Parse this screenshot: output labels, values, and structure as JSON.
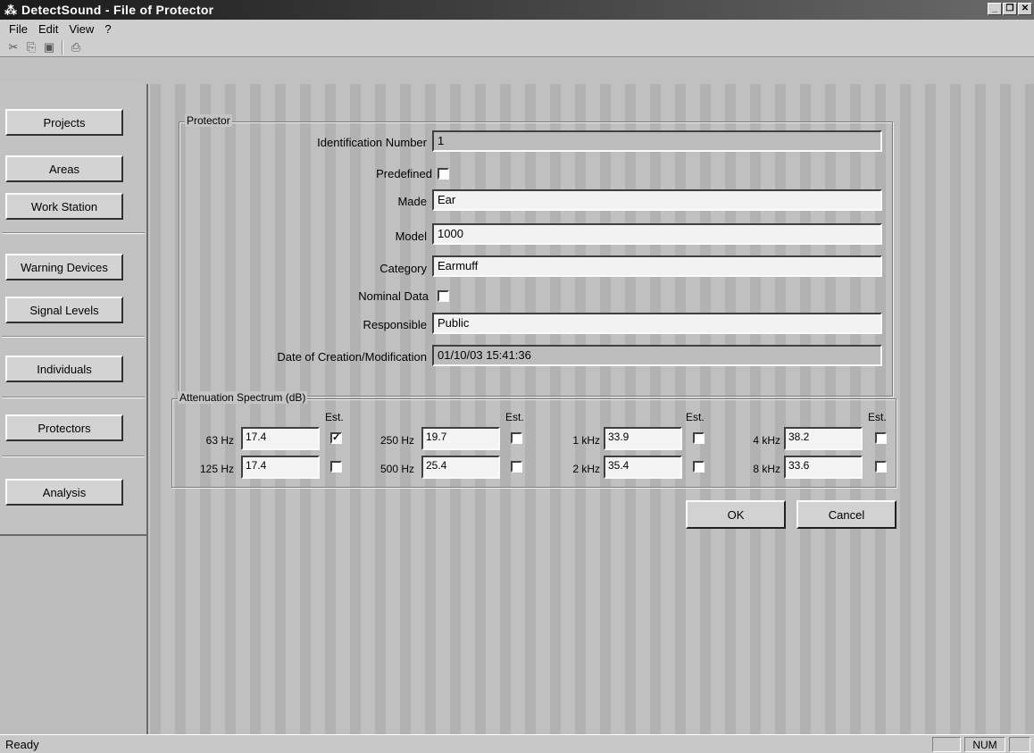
{
  "window": {
    "title": "DetectSound - File of Protector"
  },
  "menu": {
    "file": "File",
    "edit": "Edit",
    "view": "View",
    "help": "?"
  },
  "nav": {
    "projects": "Projects",
    "areas": "Areas",
    "work_station": "Work Station",
    "warning_devices": "Warning Devices",
    "signal_levels": "Signal Levels",
    "individuals": "Individuals",
    "protectors": "Protectors",
    "analysis": "Analysis"
  },
  "protector": {
    "group_title": "Protector",
    "id_label": "Identification Number",
    "id_value": "1",
    "predefined_label": "Predefined",
    "predefined_checked": false,
    "made_label": "Made",
    "made_value": "Ear",
    "model_label": "Model",
    "model_value": "1000",
    "category_label": "Category",
    "category_value": "Earmuff",
    "nominal_label": "Nominal Data",
    "nominal_checked": false,
    "responsible_label": "Responsible",
    "responsible_value": "Public",
    "date_label": "Date of Creation/Modification",
    "date_value": "01/10/03 15:41:36"
  },
  "attenuation": {
    "group_title": "Attenuation Spectrum (dB)",
    "est_label": "Est.",
    "bands": [
      {
        "freq": "63 Hz",
        "value": "17.4",
        "est": true
      },
      {
        "freq": "125 Hz",
        "value": "17.4",
        "est": false
      },
      {
        "freq": "250 Hz",
        "value": "19.7",
        "est": false
      },
      {
        "freq": "500 Hz",
        "value": "25.4",
        "est": false
      },
      {
        "freq": "1 kHz",
        "value": "33.9",
        "est": false
      },
      {
        "freq": "2 kHz",
        "value": "35.4",
        "est": false
      },
      {
        "freq": "4 kHz",
        "value": "38.2",
        "est": false
      },
      {
        "freq": "8 kHz",
        "value": "33.6",
        "est": false
      }
    ]
  },
  "buttons": {
    "ok": "OK",
    "cancel": "Cancel"
  },
  "status": {
    "text": "Ready",
    "num": "NUM"
  }
}
